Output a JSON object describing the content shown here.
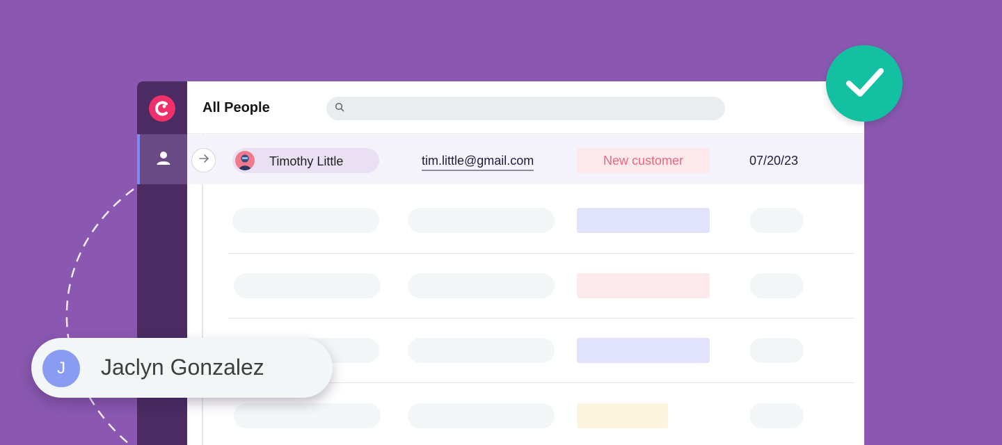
{
  "colors": {
    "background": "#8a58b0",
    "sidebar": "#4b2b62",
    "sidebar_active": "#6a4a84",
    "accent_indicator": "#7e8cf0",
    "logo": "#f0306a",
    "check_badge": "#13c1a2",
    "status_new_customer_bg": "#fde8ec",
    "status_new_customer_text": "#e8687c",
    "avatar_j": "#8a9cf2"
  },
  "sidebar": {
    "logo_icon": "brand-logo-icon",
    "items": [
      {
        "icon": "person-icon",
        "active": true
      }
    ]
  },
  "header": {
    "title": "All People",
    "search": {
      "value": "",
      "placeholder": "",
      "icon": "search-icon"
    }
  },
  "table": {
    "active_row": {
      "expand_icon": "arrow-right-icon",
      "name": "Timothy Little",
      "email": "tim.little@gmail.com",
      "status": "New customer",
      "date": "07/20/23"
    },
    "placeholder_rows": [
      {
        "badge_color": "#e0e3fb"
      },
      {
        "badge_color": "#fde8ec"
      },
      {
        "badge_color": "#e0e3fb"
      },
      {
        "badge_color": "#fdf4dd"
      }
    ]
  },
  "success_badge": {
    "icon": "checkmark-icon"
  },
  "drag_card": {
    "initial": "J",
    "name": "Jaclyn Gonzalez"
  }
}
